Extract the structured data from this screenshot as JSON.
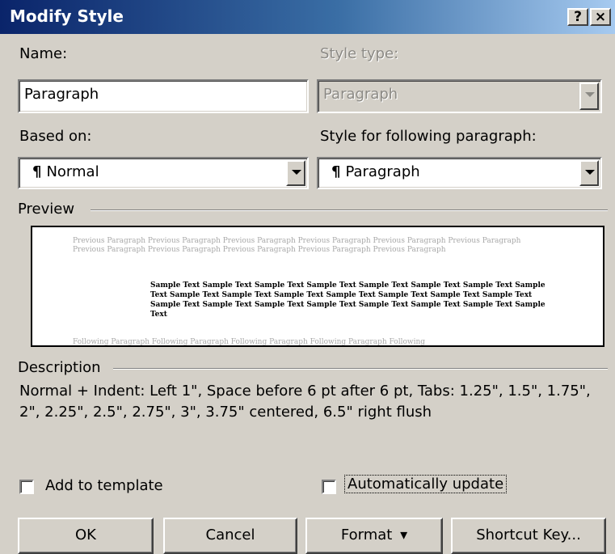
{
  "window": {
    "title": "Modify Style",
    "help_label": "?",
    "close_label": "×"
  },
  "name": {
    "label": "Name:",
    "value": "Paragraph"
  },
  "style_type": {
    "label": "Style type:",
    "value": "Paragraph"
  },
  "based_on": {
    "label": "Based on:",
    "pilcrow": "¶",
    "value": "Normal"
  },
  "following": {
    "label": "Style for following paragraph:",
    "pilcrow": "¶",
    "value": "Paragraph"
  },
  "preview": {
    "label": "Preview",
    "previous_text": "Previous Paragraph Previous Paragraph Previous Paragraph Previous Paragraph Previous Paragraph Previous Paragraph Previous Paragraph Previous Paragraph Previous Paragraph Previous Paragraph Previous Paragraph",
    "sample_text": "Sample Text Sample Text Sample Text Sample Text Sample Text Sample Text Sample Text Sample Text Sample Text Sample Text Sample Text Sample Text Sample Text Sample Text Sample Text Sample Text Sample Text Sample Text Sample Text Sample Text Sample Text Sample Text Sample Text",
    "following_text": "Following Paragraph Following Paragraph Following Paragraph Following Paragraph Following"
  },
  "description": {
    "label": "Description",
    "text": "Normal + Indent: Left 1\", Space before 6 pt after 6 pt, Tabs: 1.25\", 1.5\", 1.75\", 2\", 2.25\", 2.5\", 2.75\", 3\", 3.75\" centered, 6.5\" right flush"
  },
  "options": {
    "add_to_template": "Add to template",
    "auto_update": "Automatically update"
  },
  "buttons": {
    "ok": "OK",
    "cancel": "Cancel",
    "format": "Format",
    "format_arrow": "▾",
    "shortcut": "Shortcut Key..."
  }
}
